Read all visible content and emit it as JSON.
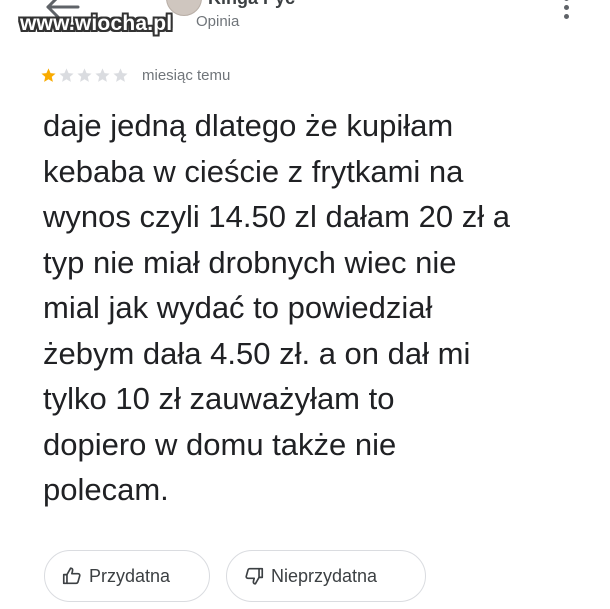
{
  "header": {
    "author_name": "Kinga Pyc",
    "review_kind": "Opinia",
    "back_icon": "arrow-back-icon",
    "more_icon": "more-vert-icon"
  },
  "watermark": {
    "text": "www.wiocha.pl"
  },
  "review": {
    "rating": 1,
    "rating_max": 5,
    "time": "miesiąc temu",
    "text": "daje jedną dlatego że kupiłam\nkebaba w cieście z frytkami na\nwynos czyli 14.50 zl dałam 20 zł a\ntyp nie miał drobnych wiec nie\nmial jak wydać to powiedział\nżebym dała 4.50 zł. a on dał mi\ntylko 10 zł zauważyłam to\ndopiero w domu także nie\npolecam."
  },
  "actions": {
    "helpful_label": "Przydatna",
    "helpful_icon": "thumb-up-icon",
    "unhelpful_label": "Nieprzydatna",
    "unhelpful_icon": "thumb-down-icon"
  },
  "colors": {
    "star_filled": "#F9AB00",
    "star_empty": "#DADCE0",
    "text": "#202124",
    "secondary_text": "#70757A",
    "chip_border": "#DADCE0"
  }
}
